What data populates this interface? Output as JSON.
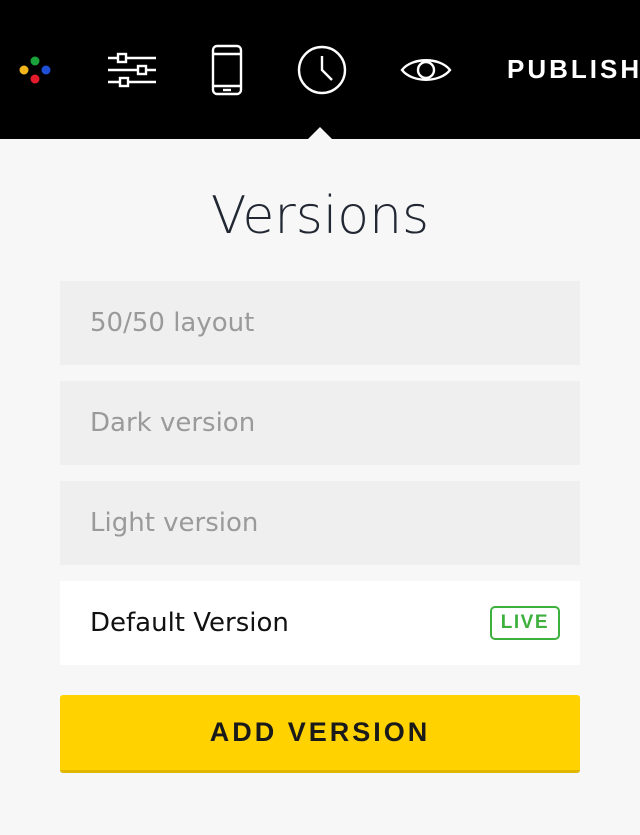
{
  "toolbar": {
    "logo_icon": "multicolor-dots-logo",
    "settings_icon": "sliders-icon",
    "mobile_icon": "mobile-phone-icon",
    "history_icon": "clock-icon",
    "preview_icon": "eye-icon",
    "publish_label": "PUBLISH",
    "active_tab": "history"
  },
  "page": {
    "title": "Versions"
  },
  "versions": [
    {
      "label": "50/50 layout",
      "current": false
    },
    {
      "label": "Dark version",
      "current": false
    },
    {
      "label": "Light version",
      "current": false
    },
    {
      "label": "Default Version",
      "current": true,
      "badge": "LIVE"
    }
  ],
  "actions": {
    "add_version_label": "ADD VERSION"
  },
  "colors": {
    "topbar": "#000000",
    "accent_yellow": "#ffd200",
    "live_green": "#3db03d",
    "logo_green": "#1aa33a",
    "logo_blue": "#1f4fd6",
    "logo_yellow": "#f2b51c",
    "logo_red": "#e41b2a"
  }
}
